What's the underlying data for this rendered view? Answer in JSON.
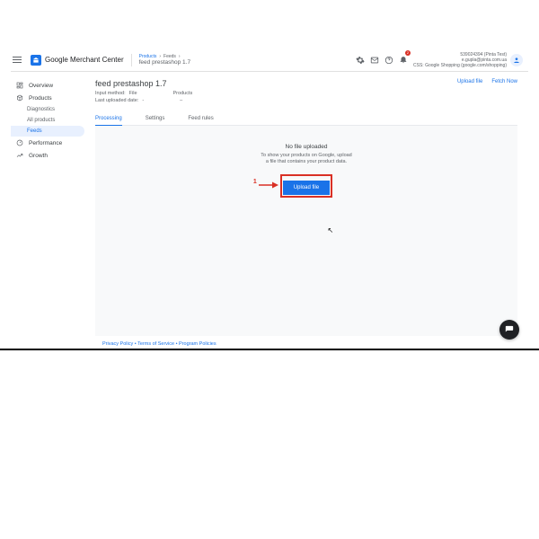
{
  "header": {
    "app_name_strong": "Google",
    "app_name_rest": " Merchant Center",
    "crumb1": "Products",
    "crumb2": "Feeds",
    "crumb_sub": "feed prestashop 1.7",
    "account_id": "539024394 (Pinta Test)",
    "account_email": "e.gupla@pinta.com.ua",
    "account_css": "CSS: Google Shopping (google.com/shopping)",
    "badge_count": "2"
  },
  "sidebar": {
    "overview": "Overview",
    "products": "Products",
    "diagnostics": "Diagnostics",
    "all_products": "All products",
    "feeds": "Feeds",
    "performance": "Performance",
    "growth": "Growth"
  },
  "main": {
    "title": "feed prestashop 1.7",
    "meta_input_label": "Input method:",
    "meta_input_value": "File",
    "meta_products_label": "Products",
    "meta_last_label": "Last uploaded date:",
    "meta_last_value1": "-",
    "meta_last_value2": "–",
    "action_upload": "Upload file",
    "action_fetch": "Fetch Now"
  },
  "tabs": {
    "processing": "Processing",
    "settings": "Settings",
    "feed_rules": "Feed rules"
  },
  "empty": {
    "title": "No file uploaded",
    "sub1": "To show your products on Google, upload",
    "sub2": "a file that contains your product data.",
    "button": "Upload file",
    "callout": "1"
  },
  "footer": "Privacy Policy • Terms of Service • Program Policies"
}
